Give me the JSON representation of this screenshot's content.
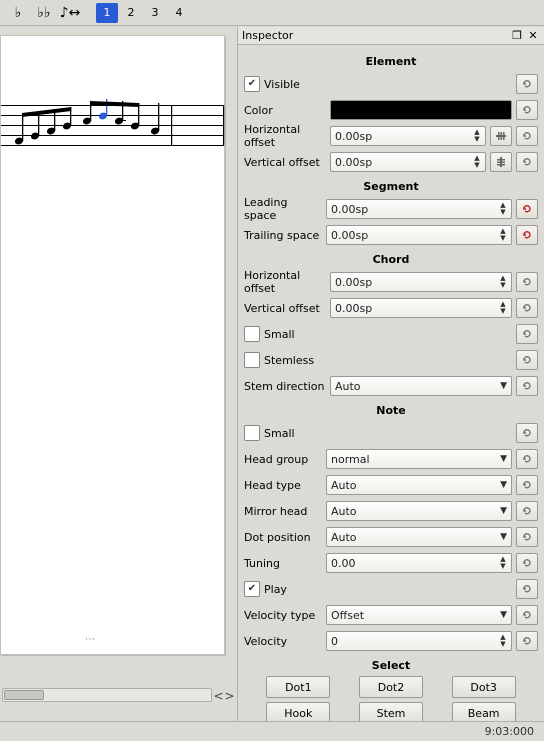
{
  "toolbar": {
    "glyph_flat": "♭",
    "glyph_dblflat": "♭♭",
    "glyph_flip": "♪↔",
    "voices": [
      "1",
      "2",
      "3",
      "4"
    ],
    "active_voice": 0
  },
  "inspector": {
    "title": "Inspector",
    "element": {
      "heading": "Element",
      "visible_label": "Visible",
      "visible_checked": true,
      "color_label": "Color",
      "color_value": "#000000",
      "hoffset_label": "Horizontal offset",
      "hoffset_value": "0.00sp",
      "voffset_label": "Vertical offset",
      "voffset_value": "0.00sp"
    },
    "segment": {
      "heading": "Segment",
      "leading_label": "Leading space",
      "leading_value": "0.00sp",
      "trailing_label": "Trailing space",
      "trailing_value": "0.00sp"
    },
    "chord": {
      "heading": "Chord",
      "hoffset_label": "Horizontal offset",
      "hoffset_value": "0.00sp",
      "voffset_label": "Vertical offset",
      "voffset_value": "0.00sp",
      "small_label": "Small",
      "stemless_label": "Stemless",
      "stemdir_label": "Stem direction",
      "stemdir_value": "Auto"
    },
    "note": {
      "heading": "Note",
      "small_label": "Small",
      "headgroup_label": "Head group",
      "headgroup_value": "normal",
      "headtype_label": "Head type",
      "headtype_value": "Auto",
      "mirror_label": "Mirror head",
      "mirror_value": "Auto",
      "dotpos_label": "Dot position",
      "dotpos_value": "Auto",
      "tuning_label": "Tuning",
      "tuning_value": "0.00",
      "play_label": "Play",
      "play_checked": true,
      "veltype_label": "Velocity type",
      "veltype_value": "Offset",
      "velocity_label": "Velocity",
      "velocity_value": "0"
    },
    "select": {
      "heading": "Select",
      "dot1": "Dot1",
      "dot2": "Dot2",
      "dot3": "Dot3",
      "hook": "Hook",
      "stem": "Stem",
      "beam": "Beam"
    }
  },
  "status": {
    "position": "9:03:000"
  }
}
